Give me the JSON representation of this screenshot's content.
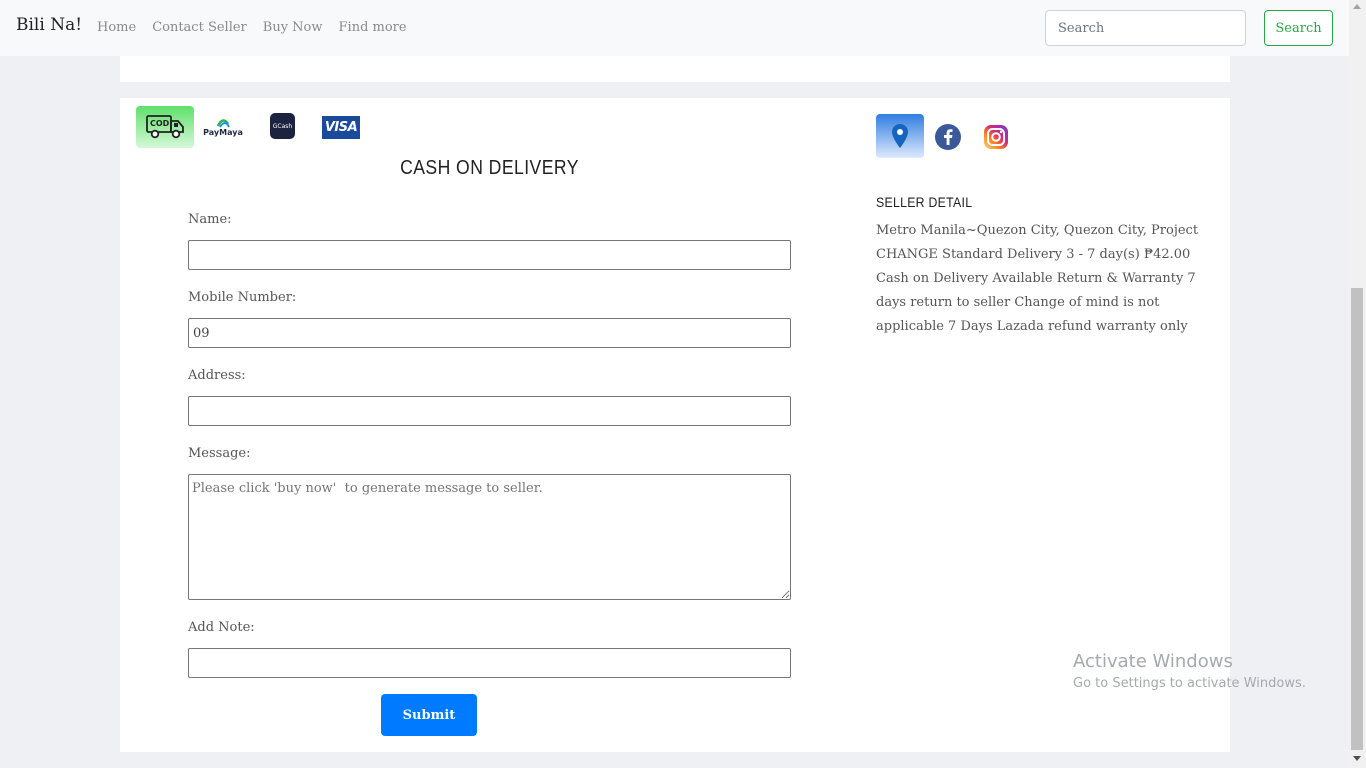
{
  "navbar": {
    "brand": "Bili Na!",
    "links": [
      "Home",
      "Contact Seller",
      "Buy Now",
      "Find more"
    ],
    "search_placeholder": "Search",
    "search_button": "Search",
    "link_color": "#8a8a8a",
    "search_button_color": "#28a745"
  },
  "payment_methods": {
    "cod_label": "COD",
    "paymaya_label": "PayMaya",
    "gcash_label": "GCash",
    "visa_label": "VISA",
    "icons": [
      "cod-truck-icon",
      "paymaya-icon",
      "gcash-icon",
      "visa-icon"
    ]
  },
  "form": {
    "heading": "CASH ON DELIVERY",
    "name_label": "Name:",
    "name_value": "",
    "mobile_label": "Mobile Number:",
    "mobile_value": "09",
    "address_label": "Address:",
    "address_value": "",
    "message_label": "Message:",
    "message_placeholder": "Please click 'buy now'  to generate message to seller.",
    "note_label": "Add Note:",
    "note_value": "",
    "submit_label": "Submit",
    "submit_color": "#007bff"
  },
  "social": {
    "icons": [
      "location-pin-icon",
      "facebook-icon",
      "instagram-icon"
    ]
  },
  "seller": {
    "title": "SELLER DETAIL",
    "detail": "Metro Manila~Quezon City, Quezon City, Project CHANGE Standard Delivery 3 - 7 day(s) ₱42.00 Cash on Delivery Available Return & Warranty 7 days return to seller Change of mind is not applicable 7 Days Lazada refund warranty only"
  },
  "watermark": {
    "title": "Activate Windows",
    "subtitle": "Go to Settings to activate Windows."
  }
}
